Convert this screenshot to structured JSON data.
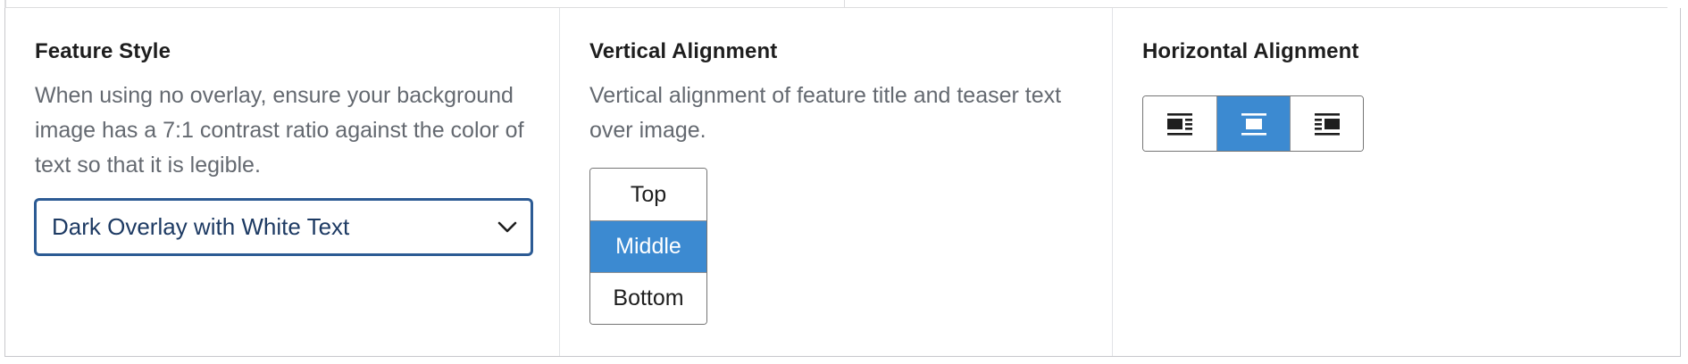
{
  "feature_style": {
    "label": "Feature Style",
    "help": "When using no overlay, ensure your background image has a 7:1 contrast ratio against the color of text so that it is legible.",
    "selected": "Dark Overlay with White Text"
  },
  "vertical_alignment": {
    "label": "Vertical Alignment",
    "help": "Vertical alignment of feature title and teaser text over image.",
    "options": [
      "Top",
      "Middle",
      "Bottom"
    ],
    "selected": "Middle"
  },
  "horizontal_alignment": {
    "label": "Horizontal Alignment",
    "options": [
      "align-left-icon",
      "align-center-icon",
      "align-right-icon"
    ],
    "selected": "align-center-icon"
  },
  "colors": {
    "accent": "#3c8ad1",
    "select_border": "#2c5b94",
    "help_text": "#646970"
  }
}
